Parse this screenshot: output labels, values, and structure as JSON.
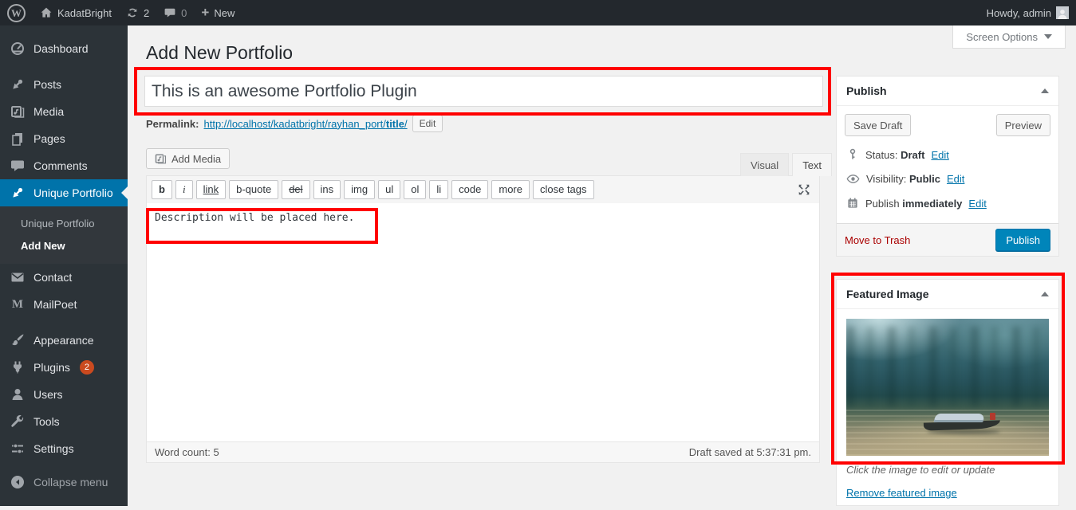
{
  "admin_bar": {
    "logo_letter": "W",
    "site_name": "KadatBright",
    "update_count": "2",
    "comment_count": "0",
    "new_plus": "+",
    "new_label": "New",
    "howdy": "Howdy, admin"
  },
  "screen_options": {
    "label": "Screen Options"
  },
  "sidebar": {
    "items": [
      {
        "label": "Dashboard"
      },
      {
        "label": "Posts"
      },
      {
        "label": "Media"
      },
      {
        "label": "Pages"
      },
      {
        "label": "Comments"
      },
      {
        "label": "Unique Portfolio"
      },
      {
        "label": "Contact"
      },
      {
        "label": "MailPoet"
      },
      {
        "label": "Appearance"
      },
      {
        "label": "Plugins",
        "badge": "2"
      },
      {
        "label": "Users"
      },
      {
        "label": "Tools"
      },
      {
        "label": "Settings"
      },
      {
        "label": "Collapse menu"
      }
    ],
    "mailpoet_letter": "M",
    "submenu": [
      {
        "label": "Unique Portfolio"
      },
      {
        "label": "Add New"
      }
    ]
  },
  "main": {
    "page_title": "Add New Portfolio",
    "title_field": {
      "value": "This is an awesome Portfolio Plugin"
    },
    "permalink": {
      "label": "Permalink:",
      "url_prefix": "http://localhost/kadatbright/rayhan_port/",
      "slug": "title",
      "url_suffix": "/",
      "edit_button": "Edit"
    },
    "editor": {
      "add_media": "Add Media",
      "tabs": {
        "visual": "Visual",
        "text": "Text"
      },
      "quicktags": [
        "b",
        "i",
        "link",
        "b-quote",
        "del",
        "ins",
        "img",
        "ul",
        "ol",
        "li",
        "code",
        "more",
        "close tags"
      ],
      "content": "Description will be placed here.",
      "word_count_label": "Word count:",
      "word_count": "5",
      "draft_saved": "Draft saved at 5:37:31 pm."
    }
  },
  "publish_box": {
    "title": "Publish",
    "save_draft": "Save Draft",
    "preview": "Preview",
    "status_label": "Status:",
    "status_value": "Draft",
    "visibility_label": "Visibility:",
    "visibility_value": "Public",
    "schedule_label": "Publish",
    "schedule_value": "immediately",
    "edit": "Edit",
    "move_to_trash": "Move to Trash",
    "publish_button": "Publish"
  },
  "featured_image_box": {
    "title": "Featured Image",
    "caption": "Click the image to edit or update",
    "remove_link": "Remove featured image"
  },
  "colors": {
    "accent_blue": "#0073aa",
    "publish_button": "#0085ba",
    "annotation_red": "#ff0000",
    "admin_bar_bg": "#23282d",
    "sidebar_bg": "#2c3338",
    "trash_red": "#a00000",
    "plugin_badge": "#ca4a1f"
  }
}
